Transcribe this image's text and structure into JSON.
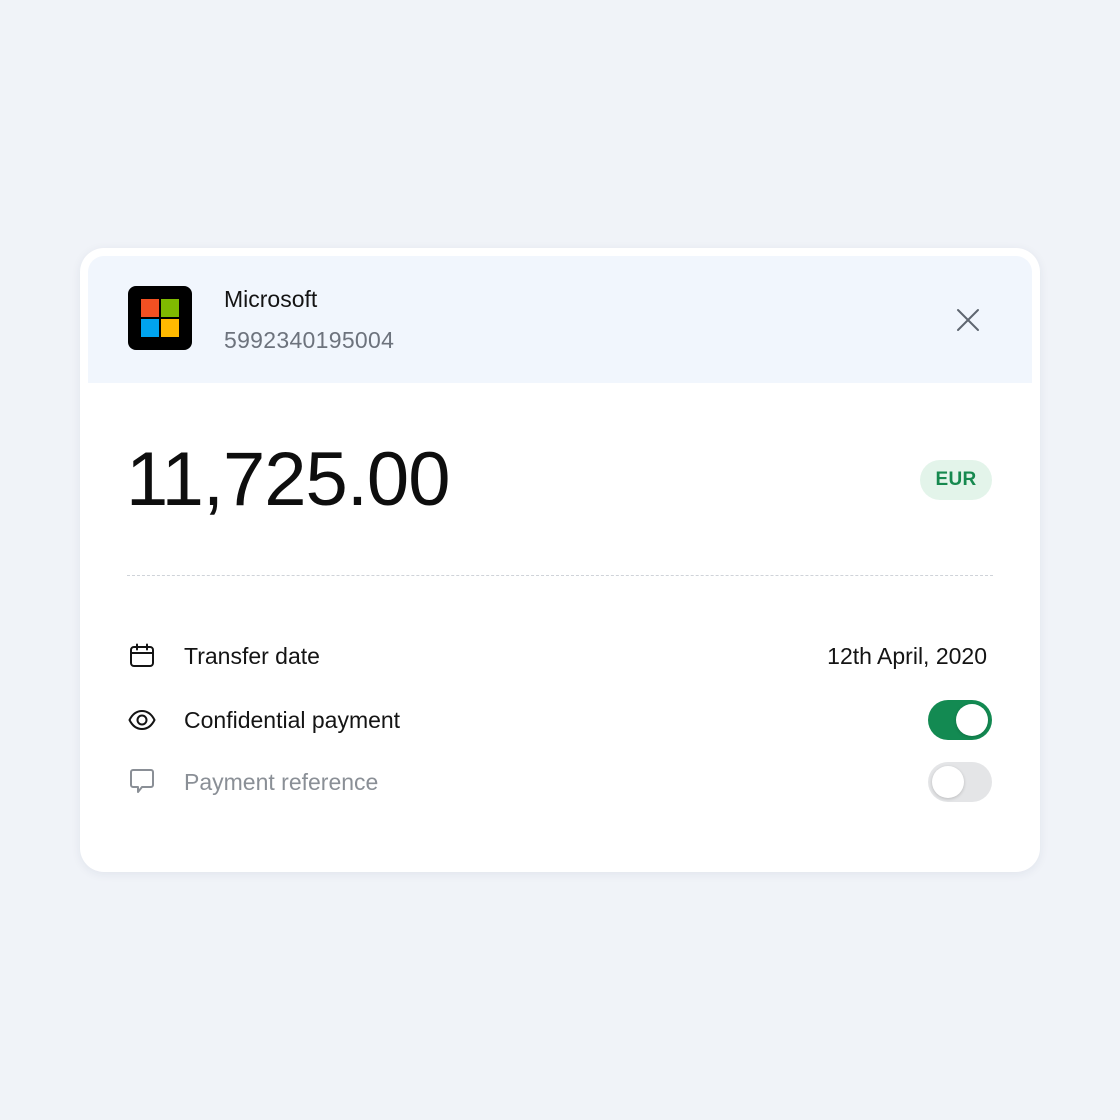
{
  "merchant": {
    "name": "Microsoft",
    "account_number": "5992340195004",
    "logo_colors": [
      "#f25022",
      "#7fba00",
      "#00a4ef",
      "#ffb900"
    ]
  },
  "amount": {
    "value": "11,725.00",
    "currency": "EUR"
  },
  "details": {
    "transfer_date": {
      "label": "Transfer date",
      "value": "12th April, 2020",
      "icon": "calendar-icon"
    },
    "confidential_payment": {
      "label": "Confidential payment",
      "enabled": true,
      "icon": "eye-icon"
    },
    "payment_reference": {
      "label": "Payment reference",
      "enabled": false,
      "icon": "comment-icon"
    }
  },
  "colors": {
    "accent_green": "#138a52",
    "badge_bg": "#e3f4ea",
    "header_bg": "#f1f6fd",
    "muted_text": "#8a8f96"
  }
}
